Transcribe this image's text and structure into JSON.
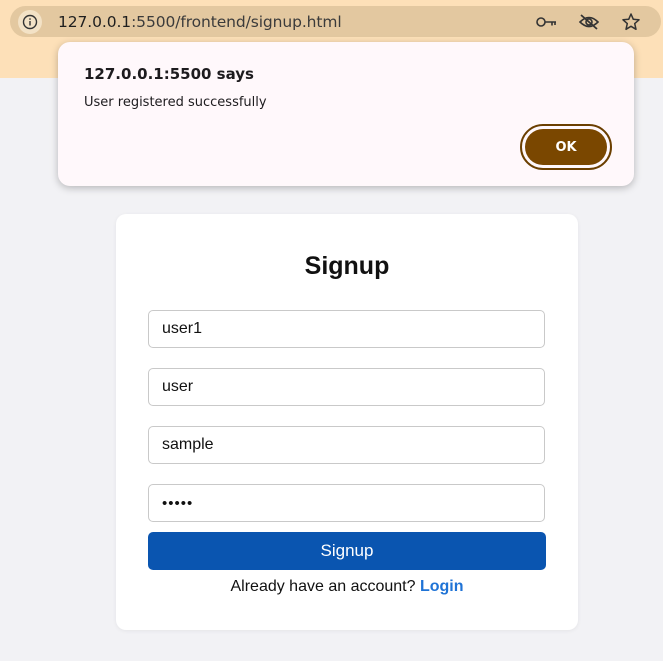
{
  "browser": {
    "url_host": "127.0.0.1",
    "url_path": ":5500/frontend/signup.html",
    "icons": [
      "info-icon",
      "key-icon",
      "eye-off-icon",
      "star-icon"
    ]
  },
  "dialog": {
    "title": "127.0.0.1:5500 says",
    "message": "User registered successfully",
    "ok_label": "OK"
  },
  "form": {
    "title": "Signup",
    "fields": [
      {
        "value": "user1"
      },
      {
        "value": "user"
      },
      {
        "value": "sample"
      },
      {
        "value": "•••••"
      }
    ],
    "submit_label": "Signup",
    "login_prompt": "Already have an account?",
    "login_link": "Login"
  },
  "colors": {
    "primary": "#0a55b0",
    "link": "#1f73d6",
    "dialog_button": "#7a4700",
    "browser_chrome": "#fde0b8"
  }
}
